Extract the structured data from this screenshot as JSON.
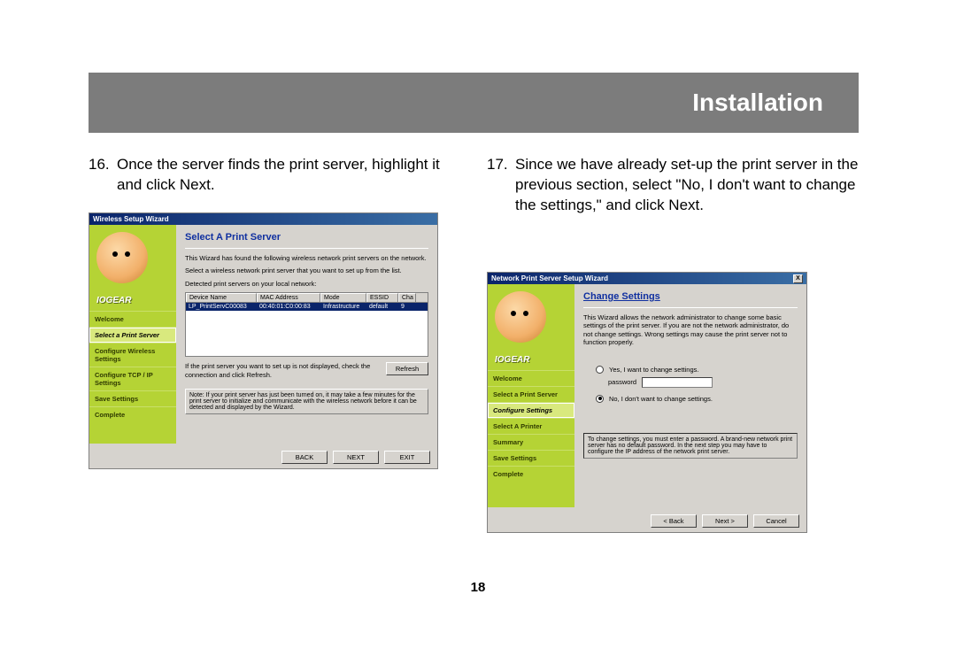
{
  "header": {
    "title": "Installation"
  },
  "page_number": "18",
  "steps": {
    "s16": {
      "num": "16.",
      "text": "Once the server finds the print server, highlight it and click Next."
    },
    "s17": {
      "num": "17.",
      "text": "Since we have already set-up the print server in the previous section, select \"No, I don't want to change the settings,\" and click Next."
    }
  },
  "dialog1": {
    "title": "Wireless Setup Wizard",
    "brand": "IOGEAR",
    "nav": [
      "Welcome",
      "Select a Print Server",
      "Configure Wireless Settings",
      "Configure TCP / IP Settings",
      "Save Settings",
      "Complete"
    ],
    "pane_title": "Select A Print Server",
    "desc1": "This Wizard has found the following wireless network print servers on the network.",
    "desc2": "Select a wireless network print server that you want to set up from the list.",
    "detected": "Detected print servers on your local network:",
    "columns": [
      "Device Name",
      "MAC Address",
      "Mode",
      "ESSID",
      "Cha"
    ],
    "row": {
      "name": "LP_PrintServC00083",
      "mac": "00:40:01:C0:00:83",
      "mode": "Infrastructure",
      "essid": "default",
      "ch": "9"
    },
    "refresh_desc": "If the print server you want to set up is not displayed, check the connection and click Refresh.",
    "refresh_btn": "Refresh",
    "note": "Note: If your print server has just been turned on, it may take a few minutes for the print server to initialize and communicate with the wireless network before it can be detected and displayed by the Wizard.",
    "buttons": {
      "back": "BACK",
      "next": "NEXT",
      "exit": "EXIT"
    }
  },
  "dialog2": {
    "title": "Network Print Server Setup Wizard",
    "close": "X",
    "brand": "IOGEAR",
    "nav": [
      "Welcome",
      "Select a Print Server",
      "Configure Settings",
      "Select A Printer",
      "Summary",
      "Save Settings",
      "Complete"
    ],
    "pane_title": "Change Settings",
    "desc": "This Wizard allows the network administrator to change some basic settings of the print server. If you are not the network administrator, do not change settings. Wrong settings may cause the print server not to function properly.",
    "opt_yes": "Yes, I want to change settings.",
    "password_label": "password",
    "opt_no": "No, I don't want to change settings.",
    "warn": "To change settings, you must enter a password. A brand-new network print server has no default password. In the next step you may have to configure the IP address of the network print server.",
    "buttons": {
      "back": "< Back",
      "next": "Next >",
      "cancel": "Cancel"
    }
  }
}
